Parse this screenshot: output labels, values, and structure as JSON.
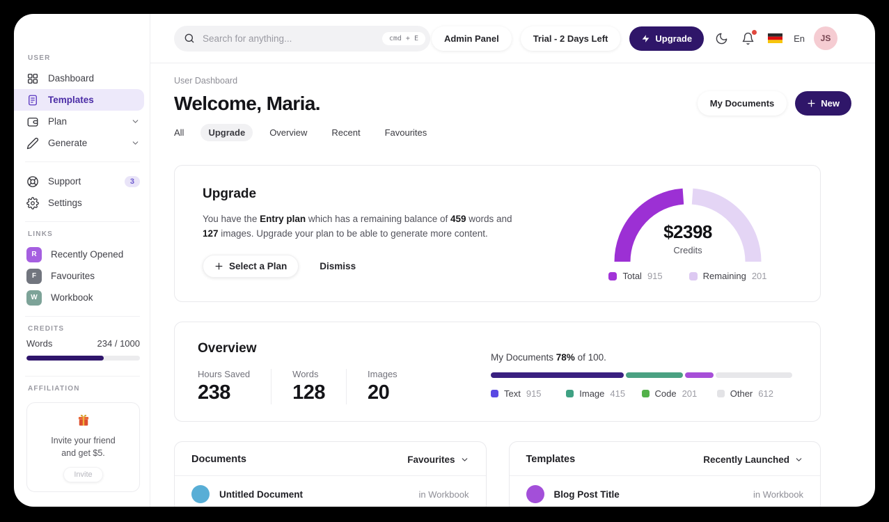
{
  "topbar": {
    "search": {
      "placeholder": "Search for anything...",
      "shortcut": "cmd + E"
    },
    "admin_panel_label": "Admin Panel",
    "trial_label": "Trial - 2 Days Left",
    "upgrade_label": "Upgrade",
    "language": "En",
    "avatar_initials": "JS"
  },
  "sidebar": {
    "sections": {
      "user": "USER",
      "links": "LINKS",
      "credits": "CREDITS",
      "affiliation": "AFFILIATION"
    },
    "items": [
      {
        "label": "Dashboard"
      },
      {
        "label": "Templates",
        "active": true
      },
      {
        "label": "Plan",
        "expandable": true
      },
      {
        "label": "Generate",
        "expandable": true
      },
      {
        "label": "Support",
        "badge": "3"
      },
      {
        "label": "Settings"
      }
    ],
    "links": [
      {
        "initial": "R",
        "label": "Recently Opened",
        "color": "#a55fe0"
      },
      {
        "initial": "F",
        "label": "Favourites",
        "color": "#71757e"
      },
      {
        "initial": "W",
        "label": "Workbook",
        "color": "#7da398"
      }
    ],
    "credits": {
      "label": "Words",
      "value": "234 / 1000",
      "fill_pct": 68,
      "bar_color": "#2f156b"
    },
    "affiliation": {
      "line1": "Invite your friend",
      "line2": "and get $5.",
      "button_label": "Invite"
    }
  },
  "header": {
    "breadcrumb": "User Dashboard",
    "title": "Welcome, Maria.",
    "my_documents_label": "My Documents",
    "new_label": "New",
    "tabs": [
      "All",
      "Upgrade",
      "Overview",
      "Recent",
      "Favourites"
    ],
    "active_tab": "Upgrade"
  },
  "upgrade_card": {
    "title": "Upgrade",
    "body": {
      "t1": "You have the ",
      "b1": "Entry plan",
      "t2": " which has a remaining balance of ",
      "b2": "459",
      "t3": " words and ",
      "b3": "127",
      "t4": " images. Upgrade your plan to be able to generate more content."
    },
    "select_plan_label": "Select a Plan",
    "dismiss_label": "Dismiss",
    "gauge": {
      "amount": "$2398",
      "caption": "Credits",
      "arc_colors": {
        "total": "#9c30d4",
        "remaining": "#e4d5f5"
      },
      "legend": [
        {
          "label": "Total",
          "value": "915",
          "color": "#a234d8"
        },
        {
          "label": "Remaining",
          "value": "201",
          "color": "#ddc9f2"
        }
      ]
    }
  },
  "overview_card": {
    "title": "Overview",
    "stats": [
      {
        "label": "Hours Saved",
        "value": "238"
      },
      {
        "label": "Words",
        "value": "128"
      },
      {
        "label": "Images",
        "value": "20"
      }
    ],
    "progress": {
      "t1": "My Documents ",
      "pct": "78%",
      "t2": " of 100."
    },
    "bar_segments": [
      {
        "name": "Text",
        "color": "#3a2080",
        "width_pct": 44
      },
      {
        "name": "Image",
        "color": "#4ba182",
        "width_pct": 19
      },
      {
        "name": "Code",
        "color": "#a74fd8",
        "width_pct": 9.5
      }
    ],
    "bar_track_color": "#e7e7ea",
    "legend": [
      {
        "label": "Text",
        "value": "915",
        "color": "#5a49e3"
      },
      {
        "label": "Image",
        "value": "415",
        "color": "#3fa183"
      },
      {
        "label": "Code",
        "value": "201",
        "color": "#53b14a"
      },
      {
        "label": "Other",
        "value": "612",
        "color": "#e3e3e6"
      }
    ]
  },
  "documents_card": {
    "title": "Documents",
    "filter_label": "Favourites",
    "rows": [
      {
        "name": "Untitled Document",
        "meta": "in Workbook",
        "avatar_color": "#58aed6"
      }
    ]
  },
  "templates_card": {
    "title": "Templates",
    "filter_label": "Recently Launched",
    "rows": [
      {
        "name": "Blog Post Title",
        "meta": "in Workbook",
        "avatar_color": "#a34fd9"
      }
    ]
  },
  "chart_data": [
    {
      "type": "pie",
      "subtype": "half-donut-gauge",
      "title": "$2398 Credits",
      "labels": [
        "Total",
        "Remaining"
      ],
      "values": [
        915,
        201
      ],
      "colors": [
        "#9c30d4",
        "#e4d5f5"
      ],
      "legend_position": "bottom"
    },
    {
      "type": "bar",
      "subtype": "stacked-progress",
      "title": "My Documents 78% of 100.",
      "labels": [
        "Text",
        "Image",
        "Code",
        "Other"
      ],
      "values": [
        915,
        415,
        201,
        612
      ],
      "colors": [
        "#5a49e3",
        "#3fa183",
        "#53b14a",
        "#e3e3e6"
      ],
      "legend_position": "bottom"
    }
  ]
}
